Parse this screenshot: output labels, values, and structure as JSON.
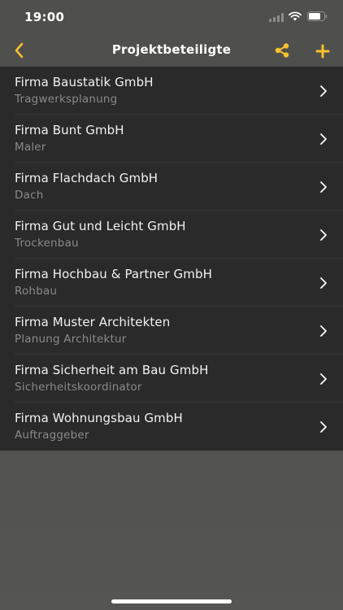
{
  "status_bar": {
    "time": "19:00"
  },
  "nav": {
    "title": "Projektbeteiligte",
    "back_icon": "chevron-left-icon",
    "share_icon": "share-icon",
    "add_icon": "plus-icon",
    "accent_color": "#f7c22e"
  },
  "list": {
    "items": [
      {
        "title": "Firma Baustatik GmbH",
        "subtitle": "Tragwerksplanung"
      },
      {
        "title": "Firma Bunt GmbH",
        "subtitle": "Maler"
      },
      {
        "title": "Firma Flachdach GmbH",
        "subtitle": "Dach"
      },
      {
        "title": "Firma Gut und Leicht GmbH",
        "subtitle": "Trockenbau"
      },
      {
        "title": "Firma Hochbau & Partner GmbH",
        "subtitle": "Rohbau"
      },
      {
        "title": "Firma Muster Architekten",
        "subtitle": "Planung Architektur"
      },
      {
        "title": "Firma Sicherheit am Bau GmbH",
        "subtitle": "Sicherheitskoordinator"
      },
      {
        "title": "Firma Wohnungsbau GmbH",
        "subtitle": "Auftraggeber"
      }
    ]
  }
}
